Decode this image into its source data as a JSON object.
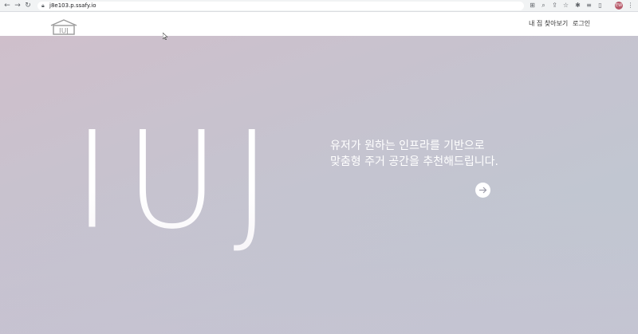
{
  "browser": {
    "url": "j8e103.p.ssafy.io",
    "profile_initials": "EW"
  },
  "header": {
    "logo_text": "IUJ",
    "nav": [
      {
        "label": "내 집 찾아보기"
      },
      {
        "label": "로그인"
      }
    ]
  },
  "hero": {
    "brand": "IUJ",
    "tagline_line1": "유저가 원하는 인프라를 기반으로",
    "tagline_line2": "맞춤형 주거 공간을 추천해드립니다."
  },
  "colors": {
    "hero_gradient_start": "#cfbfcb",
    "hero_gradient_end": "#c0c8d2",
    "text": "#ffffff"
  }
}
